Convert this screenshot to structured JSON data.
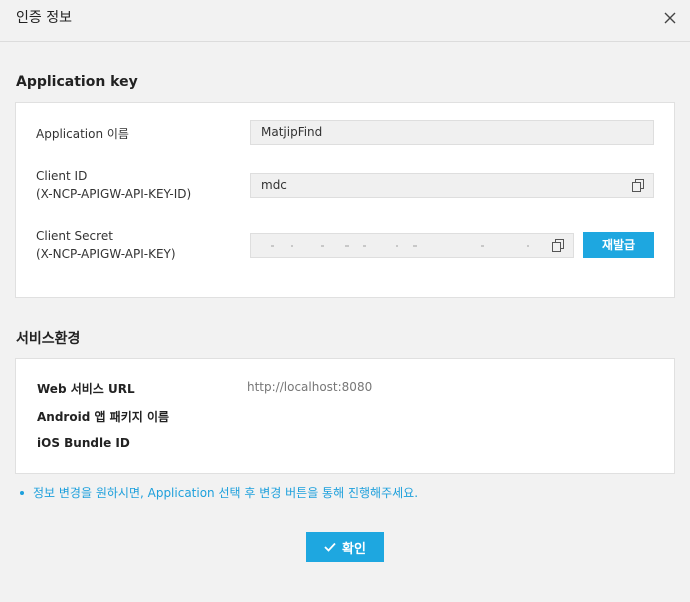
{
  "dialog": {
    "title": "인증 정보",
    "close_icon": "close-icon"
  },
  "application_key": {
    "section_title": "Application key",
    "app_name": {
      "label": "Application 이름",
      "value": "MatjipFind"
    },
    "client_id": {
      "label_line1": "Client ID",
      "label_line2": "(X-NCP-APIGW-API-KEY-ID)",
      "value": "mdc",
      "copy_icon": "copy-icon"
    },
    "client_secret": {
      "label_line1": "Client Secret",
      "label_line2": "(X-NCP-APIGW-API-KEY)",
      "value": "",
      "copy_icon": "copy-icon",
      "reissue_label": "재발급"
    }
  },
  "service_env": {
    "section_title": "서비스환경",
    "web_url": {
      "label": "Web 서비스 URL",
      "value": "http://localhost:8080"
    },
    "android": {
      "label": "Android 앱 패키지 이름",
      "value": ""
    },
    "ios": {
      "label": "iOS Bundle ID",
      "value": ""
    }
  },
  "notice": "정보 변경을 원하시면, Application 선택 후 변경 버튼을 통해 진행해주세요.",
  "footer": {
    "confirm_label": "확인",
    "confirm_icon": "check-icon"
  },
  "colors": {
    "accent": "#1ea7e0",
    "background": "#f2f2f2",
    "panel": "#ffffff",
    "field": "#f0f0f0"
  }
}
